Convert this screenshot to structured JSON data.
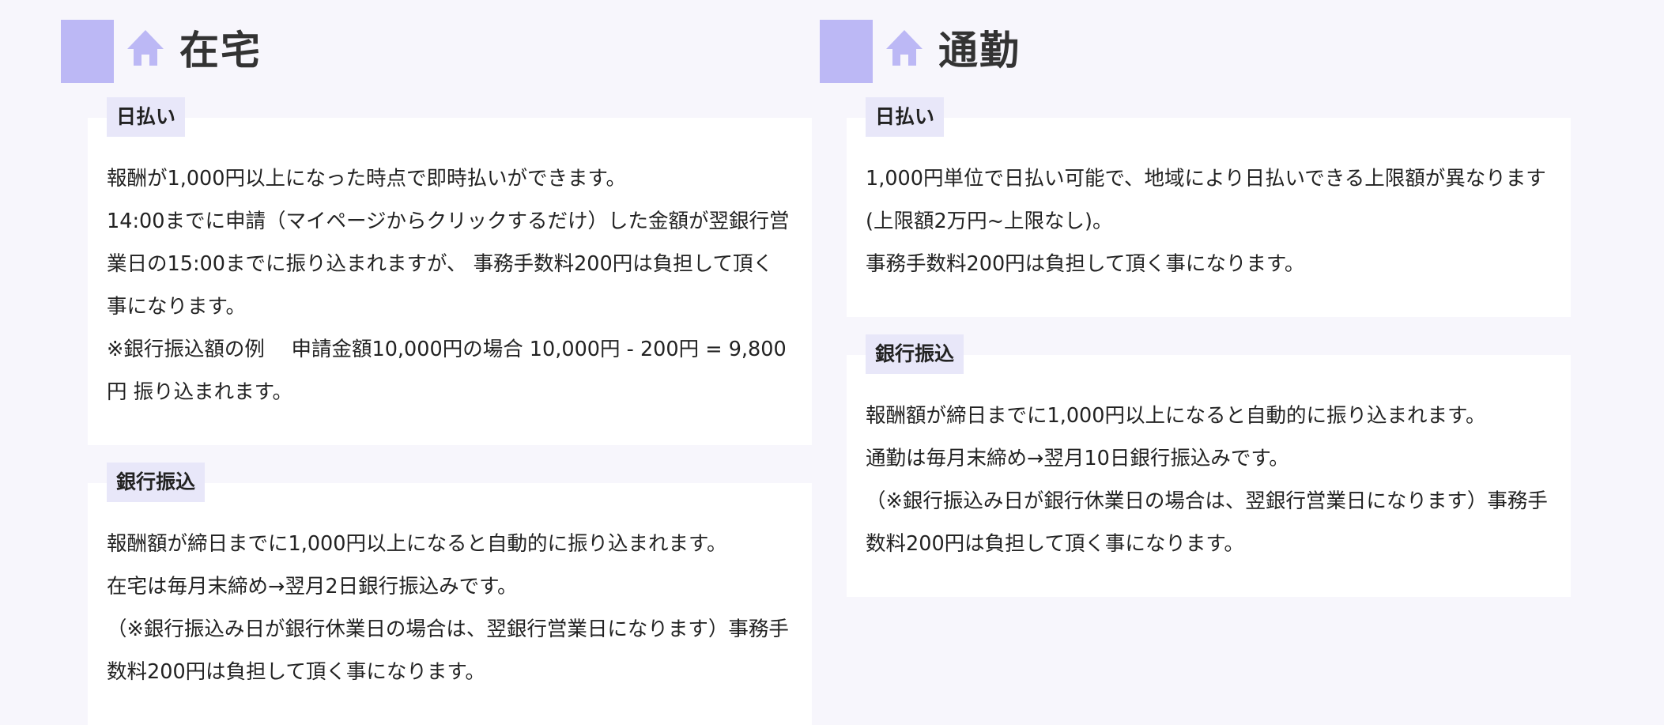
{
  "columns": [
    {
      "title": "在宅",
      "sections": [
        {
          "tag": "日払い",
          "paragraphs": [
            "報酬が1,000円以上になった時点で即時払いができます。",
            "14:00までに申請（マイページからクリックするだけ）した金額が翌銀行営業日の15:00までに振り込まれますが、 事務手数料200円は負担して頂く事になります。",
            "※銀行振込額の例　 申請金額10,000円の場合 10,000円 - 200円 = 9,800円 振り込まれます。"
          ]
        },
        {
          "tag": "銀行振込",
          "paragraphs": [
            "報酬額が締日までに1,000円以上になると自動的に振り込まれます。",
            "在宅は毎月末締め→翌月2日銀行振込みです。",
            "（※銀行振込み日が銀行休業日の場合は、翌銀行営業日になります）事務手数料200円は負担して頂く事になります。"
          ]
        }
      ]
    },
    {
      "title": "通勤",
      "sections": [
        {
          "tag": "日払い",
          "paragraphs": [
            "1,000円単位で日払い可能で、地域により日払いできる上限額が異なります(上限額2万円~上限なし)。",
            "事務手数料200円は負担して頂く事になります。"
          ]
        },
        {
          "tag": "銀行振込",
          "paragraphs": [
            "報酬額が締日までに1,000円以上になると自動的に振り込まれます。",
            "通勤は毎月末締め→翌月10日銀行振込みです。",
            "（※銀行振込み日が銀行休業日の場合は、翌銀行営業日になります）事務手数料200円は負担して頂く事になります。"
          ]
        }
      ]
    }
  ],
  "colors": {
    "accent": "#bcb8f5",
    "tag_background": "#e8e7f9",
    "page_background": "#f7f6fc",
    "card_background": "#ffffff"
  },
  "icons": {
    "header": "home-icon"
  }
}
